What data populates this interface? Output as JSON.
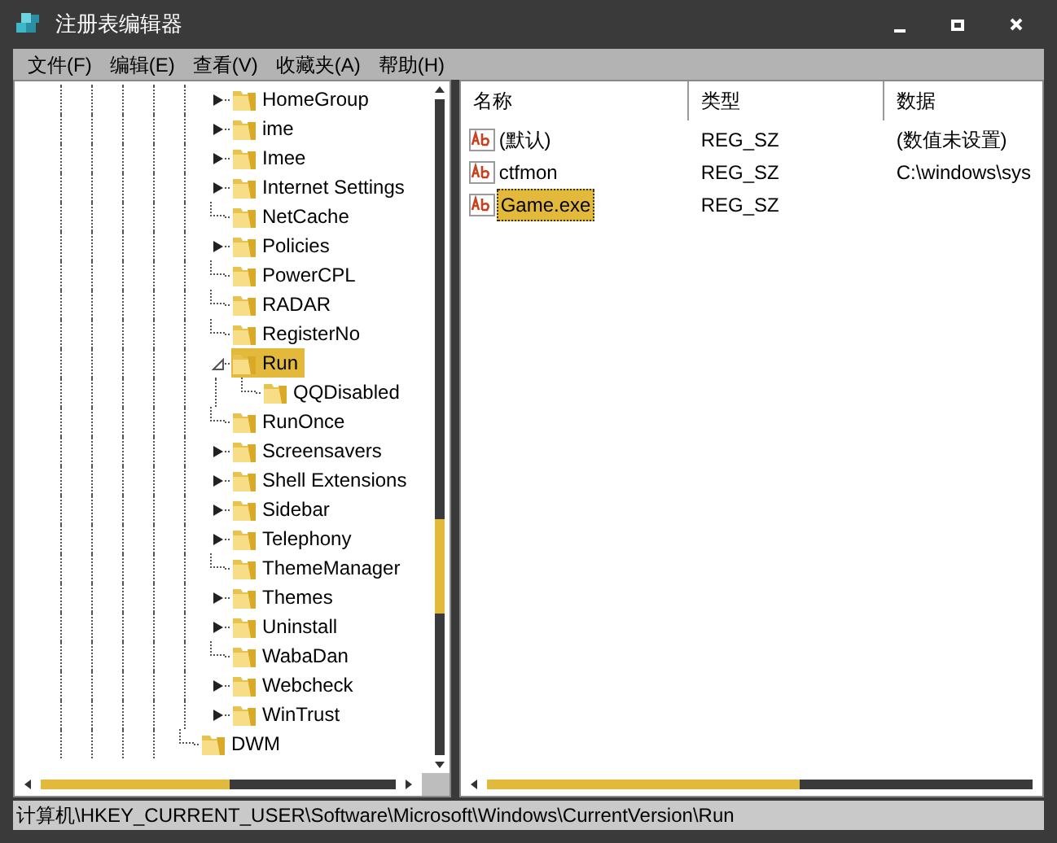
{
  "window": {
    "title": "注册表编辑器"
  },
  "menu": [
    "文件(F)",
    "编辑(E)",
    "查看(V)",
    "收藏夹(A)",
    "帮助(H)"
  ],
  "tree": [
    {
      "children": [
        {
          "label": "HomeGroup",
          "expandable": true,
          "expanded": false,
          "selected": false
        },
        {
          "label": "ime",
          "expandable": true,
          "expanded": false,
          "selected": false
        },
        {
          "label": "Imee",
          "expandable": true,
          "expanded": false,
          "selected": false
        },
        {
          "label": "Internet Settings",
          "expandable": true,
          "expanded": false,
          "selected": false
        },
        {
          "label": "NetCache",
          "expandable": false,
          "selected": false
        },
        {
          "label": "Policies",
          "expandable": true,
          "expanded": false,
          "selected": false
        },
        {
          "label": "PowerCPL",
          "expandable": false,
          "selected": false
        },
        {
          "label": "RADAR",
          "expandable": false,
          "selected": false
        },
        {
          "label": "RegisterNo",
          "expandable": false,
          "selected": false
        },
        {
          "label": "Run",
          "expandable": true,
          "expanded": true,
          "selected": true,
          "children": [
            {
              "label": "QQDisabled",
              "expandable": false,
              "selected": false
            }
          ]
        },
        {
          "label": "RunOnce",
          "expandable": false,
          "selected": false
        },
        {
          "label": "Screensavers",
          "expandable": true,
          "expanded": false,
          "selected": false
        },
        {
          "label": "Shell Extensions",
          "expandable": true,
          "expanded": false,
          "selected": false
        },
        {
          "label": "Sidebar",
          "expandable": true,
          "expanded": false,
          "selected": false
        },
        {
          "label": "Telephony",
          "expandable": true,
          "expanded": false,
          "selected": false
        },
        {
          "label": "ThemeManager",
          "expandable": false,
          "selected": false
        },
        {
          "label": "Themes",
          "expandable": true,
          "expanded": false,
          "selected": false
        },
        {
          "label": "Uninstall",
          "expandable": true,
          "expanded": false,
          "selected": false
        },
        {
          "label": "WabaDan",
          "expandable": false,
          "selected": false
        },
        {
          "label": "Webcheck",
          "expandable": true,
          "expanded": false,
          "selected": false
        },
        {
          "label": "WinTrust",
          "expandable": true,
          "expanded": false,
          "selected": false
        }
      ]
    },
    {
      "label": "DWM",
      "expandable": false,
      "selected": false
    }
  ],
  "table": {
    "columns": [
      "名称",
      "类型",
      "数据"
    ],
    "rows": [
      {
        "name": "(默认)",
        "type": "REG_SZ",
        "data": "(数值未设置)",
        "selected": false
      },
      {
        "name": "ctfmon",
        "type": "REG_SZ",
        "data": "C:\\windows\\sys",
        "selected": false
      },
      {
        "name": "Game.exe",
        "type": "REG_SZ",
        "selected": true
      }
    ]
  },
  "status_bar": "计算机\\HKEY_CURRENT_USER\\Software\\Microsoft\\Windows\\CurrentVersion\\Run"
}
